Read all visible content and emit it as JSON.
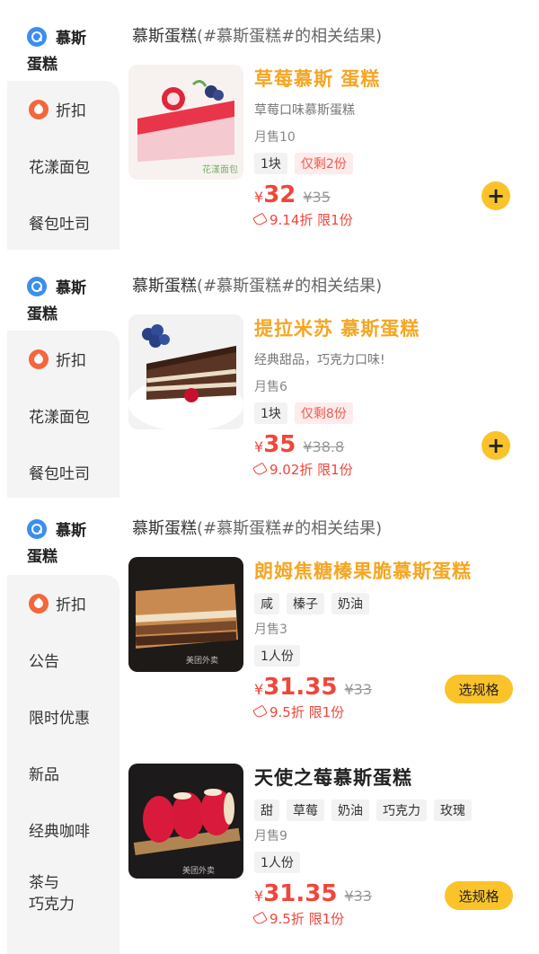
{
  "sidebar_active": {
    "line1": "慕斯",
    "line2": "蛋糕"
  },
  "section_title": {
    "main": "慕斯蛋糕",
    "sub": "(#慕斯蛋糕#的相关结果)"
  },
  "panel1": {
    "sidebar": [
      "折扣",
      "花漾面包",
      "餐包吐司"
    ],
    "product": {
      "name": "草莓慕斯 蛋糕",
      "desc": "草莓口味慕斯蛋糕",
      "sold": "月售10",
      "tags": [
        "1块",
        "仅剩2份"
      ],
      "yen": "¥",
      "price": "32",
      "orig": "¥35",
      "discount": "9.14折 限1份",
      "action": "+"
    }
  },
  "panel2": {
    "sidebar": [
      "折扣",
      "花漾面包",
      "餐包吐司"
    ],
    "product": {
      "name": "提拉米苏 慕斯蛋糕",
      "desc": "经典甜品，巧克力口味!",
      "sold": "月售6",
      "tags": [
        "1块",
        "仅剩8份"
      ],
      "yen": "¥",
      "price": "35",
      "orig": "¥38.8",
      "discount": "9.02折 限1份",
      "action": "+"
    }
  },
  "panel3": {
    "sidebar": [
      "折扣",
      "公告",
      "限时优惠",
      "新品",
      "经典咖啡",
      "茶与\n巧克力"
    ],
    "products": [
      {
        "name": "朗姆焦糖榛果脆慕斯蛋糕",
        "flavors": [
          "咸",
          "榛子",
          "奶油"
        ],
        "sold": "月售3",
        "tags": [
          "1人份"
        ],
        "yen": "¥",
        "price": "31.35",
        "orig": "¥33",
        "discount": "9.5折 限1份",
        "action": "选规格"
      },
      {
        "name": "天使之莓慕斯蛋糕",
        "flavors": [
          "甜",
          "草莓",
          "奶油",
          "巧克力",
          "玫瑰"
        ],
        "sold": "月售9",
        "tags": [
          "1人份"
        ],
        "yen": "¥",
        "price": "31.35",
        "orig": "¥33",
        "discount": "9.5折 限1份",
        "action": "选规格"
      }
    ]
  },
  "image_watermark": "美团外卖",
  "colors": {
    "accent": "#fbc32a",
    "title_orange": "#f5a623",
    "price_red": "#f2453a",
    "search_blue": "#3b8ef0",
    "discount_orange": "#f5663a"
  }
}
